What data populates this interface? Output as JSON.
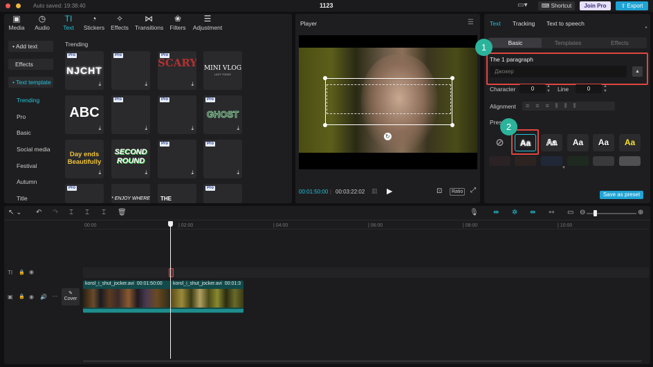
{
  "app": {
    "title": "1123",
    "autosave": "Auto saved: 19:38:40",
    "shortcut": "Shortcut",
    "join_pro": "Join Pro",
    "export": "Export"
  },
  "colors": {
    "accent": "#25c3d8",
    "highlight": "#e0463f",
    "badge": "#2bb39b"
  },
  "tabs": [
    {
      "label": "Media",
      "icon": "media-icon"
    },
    {
      "label": "Audio",
      "icon": "audio-icon"
    },
    {
      "label": "Text",
      "icon": "text-icon"
    },
    {
      "label": "Stickers",
      "icon": "stickers-icon"
    },
    {
      "label": "Effects",
      "icon": "effects-icon"
    },
    {
      "label": "Transitions",
      "icon": "transitions-icon"
    },
    {
      "label": "Filters",
      "icon": "filters-icon"
    },
    {
      "label": "Adjustment",
      "icon": "adjustment-icon"
    }
  ],
  "sidebar": {
    "add_text": "• Add text",
    "effects": "Effects",
    "text_template": "• Text template",
    "items": [
      "Trending",
      "Pro",
      "Basic",
      "Social media",
      "Festival",
      "Autumn",
      "Title"
    ]
  },
  "library": {
    "heading": "Trending",
    "pro_badge": "Pro",
    "tiles": [
      "NJCHT",
      "",
      "SCARY",
      "MINI VLOG",
      "ABC",
      "",
      "",
      "GHOST",
      "Day ends Beautifully",
      "SECOND ROUND",
      "",
      "",
      "",
      "* ENJOY WHERE",
      "THE",
      "",
      ""
    ],
    "mini_vlog_sub": "LAZY TODAY"
  },
  "player": {
    "title": "Player",
    "time_current": "00:01:50:00",
    "time_total": "00:03:22:02",
    "ratio": "Ratio"
  },
  "right": {
    "tabs": [
      "Text",
      "Tracking",
      "Text to speech"
    ],
    "subtabs": [
      "Basic",
      "Templates",
      "Effects"
    ],
    "paragraph_label": "The 1 paragraph",
    "paragraph_value": "Джокер",
    "character_label": "Character",
    "character_value": "0",
    "line_label": "Line",
    "line_value": "0",
    "alignment_label": "Alignment",
    "presets_label": "Presets",
    "preset_glyph": "Aa",
    "save_preset": "Save as preset",
    "badge1": "1",
    "badge2": "2"
  },
  "timeline": {
    "ticks": [
      "00:00",
      "| 02:00",
      "| 04:00",
      "| 06:00",
      "| 08:00",
      "| 10:00"
    ],
    "clip1_name": "korol_i_shut_jocker.avi",
    "clip1_time": "00:01:50:00",
    "clip2_name": "korol_i_shut_jocker.avi",
    "clip2_time": "00:01:3",
    "cover": "Cover",
    "text_track_icon": "TI"
  }
}
